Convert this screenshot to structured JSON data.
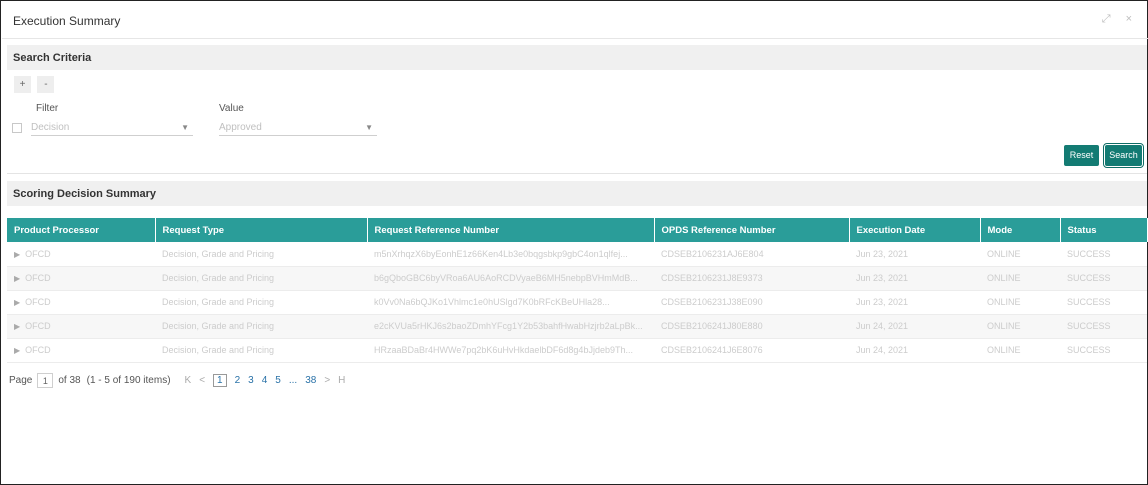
{
  "window": {
    "title": "Execution Summary",
    "controls": "⤢ ×"
  },
  "search_criteria": {
    "title": "Search Criteria",
    "add_label": "+",
    "remove_label": "-",
    "filter_label": "Filter",
    "filter_value": "Decision",
    "value_label": "Value",
    "value_value": "Approved",
    "dropdown_arrow": "▼",
    "reset_label": "Reset",
    "search_label": "Search"
  },
  "summary": {
    "title": "Scoring Decision Summary"
  },
  "table": {
    "headers": [
      "Product Processor",
      "Request Type",
      "Request Reference Number",
      "OPDS Reference Number",
      "Execution Date",
      "Mode",
      "Status"
    ],
    "rows": [
      [
        "OFCD",
        "Decision, Grade and Pricing",
        "m5nXrhqzX6byEonhE1z66Ken4Lb3e0bqgsbkp9gbC4on1qlfej...",
        "CDSEB2106231AJ6E804",
        "Jun 23, 2021",
        "ONLINE",
        "SUCCESS"
      ],
      [
        "OFCD",
        "Decision, Grade and Pricing",
        "b6gQboGBC6byVRoa6AU6AoRCDVyaeB6MH5nebpBVHmMdB...",
        "CDSEB2106231J8E9373",
        "Jun 23, 2021",
        "ONLINE",
        "SUCCESS"
      ],
      [
        "OFCD",
        "Decision, Grade and Pricing",
        "k0Vv0Na6bQJKo1Vhlmc1e0hUSlgd7K0bRFcKBeUHla28...",
        "CDSEB2106231J38E090",
        "Jun 23, 2021",
        "ONLINE",
        "SUCCESS"
      ],
      [
        "OFCD",
        "Decision, Grade and Pricing",
        "e2cKVUa5rHKJ6s2baoZDmhYFcg1Y2b53bahfHwabHzjrb2aLpBk...",
        "CDSEB2106241J80E880",
        "Jun 24, 2021",
        "ONLINE",
        "SUCCESS"
      ],
      [
        "OFCD",
        "Decision, Grade and Pricing",
        "HRzaaBDaBr4HWWe7pq2bK6uHvHkdaelbDF6d8g4bJjdeb9Th...",
        "CDSEB2106241J6E8076",
        "Jun 24, 2021",
        "ONLINE",
        "SUCCESS"
      ]
    ]
  },
  "pager": {
    "page_label": "Page",
    "current_page": "1",
    "of_text": "of 38",
    "items_text": "(1 - 5 of 190 items)",
    "first": "K",
    "prev": "<",
    "pages": [
      "1",
      "2",
      "3",
      "4",
      "5",
      "...",
      "38"
    ],
    "next": ">",
    "last": "H"
  }
}
